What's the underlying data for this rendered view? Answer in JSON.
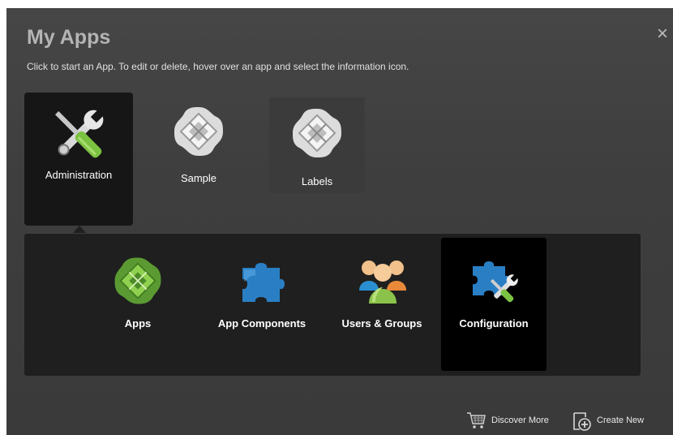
{
  "dialog": {
    "title": "My Apps",
    "subtitle": "Click to start an App. To edit or delete, hover over an app and select the information icon.",
    "close_label": "×"
  },
  "apps": [
    {
      "label": "Administration",
      "icon": "wrench-screwdriver-icon",
      "selected": true
    },
    {
      "label": "Sample",
      "icon": "app-diamond-icon"
    },
    {
      "label": "Labels",
      "icon": "app-diamond-icon"
    }
  ],
  "admin_panel": {
    "items": [
      {
        "label": "Apps",
        "icon": "app-diamond-green-icon"
      },
      {
        "label": "App Components",
        "icon": "puzzle-piece-icon"
      },
      {
        "label": "Users & Groups",
        "icon": "users-group-icon"
      },
      {
        "label": "Configuration",
        "icon": "puzzle-tools-icon",
        "active": true
      }
    ]
  },
  "footer": {
    "discover_label": "Discover More",
    "create_label": "Create New"
  },
  "colors": {
    "background": "#3f3f3f",
    "panel": "#1f1f1f",
    "selected_tile": "#161616",
    "puzzle_blue": "#2a7fc4",
    "green": "#6db33f"
  }
}
